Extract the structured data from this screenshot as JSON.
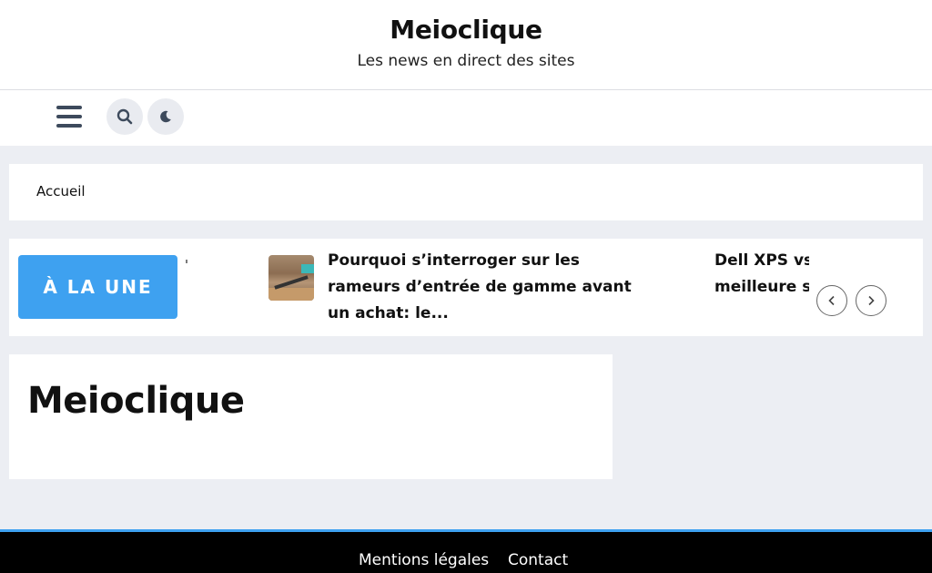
{
  "header": {
    "site_title": "Meioclique",
    "tagline": "Les news en direct des sites"
  },
  "navbar": {
    "menu_icon": "hamburger-menu-icon",
    "search_icon": "search-icon",
    "dark_mode_icon": "moon-icon"
  },
  "breadcrumb": {
    "items": [
      "Accueil"
    ]
  },
  "ticker": {
    "badge": "À LA UNE",
    "items": [
      {
        "title": "Pourquoi s’interroger sur les rameurs d’entrée de gamme avant un achat: le..."
      },
      {
        "title_line1": "Dell XPS vs L",
        "title_line2": "meilleure sér"
      }
    ],
    "prev_icon": "chevron-left-icon",
    "next_icon": "chevron-right-icon"
  },
  "main": {
    "title": "Meioclique"
  },
  "footer": {
    "links": [
      "Mentions légales",
      "Contact"
    ]
  },
  "colors": {
    "accent": "#3ea1f0",
    "page_background": "#eceef3",
    "footer_background": "#000000"
  }
}
